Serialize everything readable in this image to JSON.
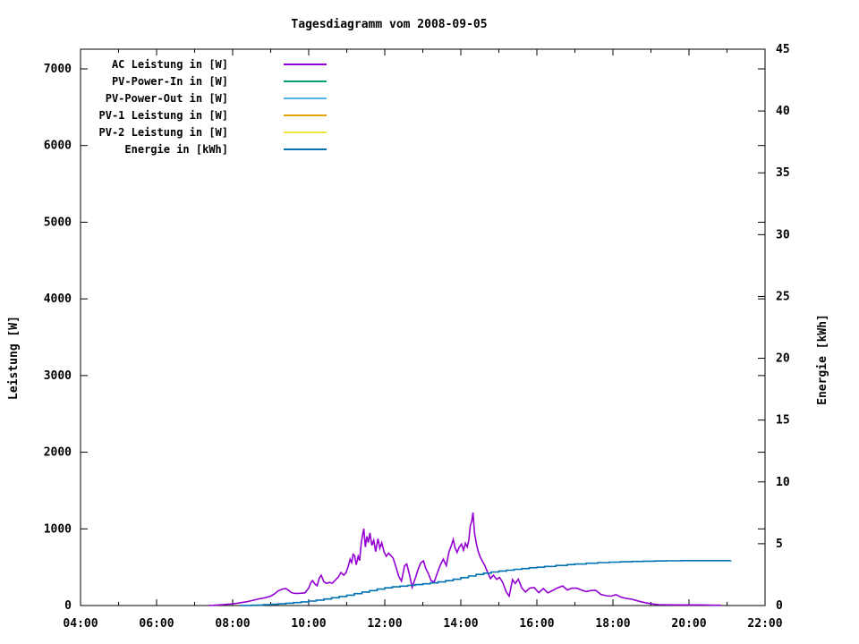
{
  "title": "Tagesdiagramm vom 2008-09-05",
  "colors": {
    "background": "#ffffff",
    "foreground": "#000000",
    "ac": "#9400d3",
    "pv_power_in": "#009e73",
    "pv_power_out": "#56b4e9",
    "pv1": "#e69f00",
    "pv2": "#f0e442",
    "energie": "#0072b2"
  },
  "chart_data": {
    "type": "line",
    "title": "Tagesdiagramm vom 2008-09-05",
    "grid": false,
    "legend_position": "top-left-inside",
    "x_axis": {
      "unit": "time-of-day",
      "min": 4,
      "max": 22,
      "major_tick_hours": 2,
      "minor_tick_hours": 1,
      "tick_labels": [
        "04:00",
        "06:00",
        "08:00",
        "10:00",
        "12:00",
        "14:00",
        "16:00",
        "18:00",
        "20:00",
        "22:00"
      ]
    },
    "y_axis_left": {
      "label": "Leistung [W]",
      "min": 0,
      "max": 7000,
      "tick_step": 1000,
      "tick_labels": [
        "0",
        "1000",
        "2000",
        "3000",
        "4000",
        "5000",
        "6000",
        "7000"
      ]
    },
    "y_axis_right": {
      "label": "Energie [kWh]",
      "min": 0,
      "max": 45,
      "tick_step": 5,
      "tick_labels": [
        "0",
        "5",
        "10",
        "15",
        "20",
        "25",
        "30",
        "35",
        "40",
        "45"
      ]
    },
    "series": [
      {
        "id": "ac-leistung",
        "name": "AC Leistung in [W]",
        "color": "#9400d3",
        "axis": "left",
        "step": false,
        "points": [
          [
            7.38,
            2
          ],
          [
            7.5,
            4
          ],
          [
            7.65,
            8
          ],
          [
            7.8,
            14
          ],
          [
            7.95,
            20
          ],
          [
            8.1,
            28
          ],
          [
            8.25,
            40
          ],
          [
            8.4,
            52
          ],
          [
            8.55,
            70
          ],
          [
            8.7,
            88
          ],
          [
            8.85,
            102
          ],
          [
            9.0,
            122
          ],
          [
            9.1,
            152
          ],
          [
            9.2,
            192
          ],
          [
            9.3,
            215
          ],
          [
            9.4,
            222
          ],
          [
            9.48,
            195
          ],
          [
            9.55,
            168
          ],
          [
            9.65,
            158
          ],
          [
            9.78,
            160
          ],
          [
            9.9,
            166
          ],
          [
            10.0,
            228
          ],
          [
            10.05,
            292
          ],
          [
            10.1,
            325
          ],
          [
            10.16,
            282
          ],
          [
            10.22,
            258
          ],
          [
            10.28,
            360
          ],
          [
            10.33,
            396
          ],
          [
            10.4,
            310
          ],
          [
            10.47,
            288
          ],
          [
            10.55,
            302
          ],
          [
            10.62,
            290
          ],
          [
            10.7,
            330
          ],
          [
            10.78,
            372
          ],
          [
            10.85,
            432
          ],
          [
            10.92,
            396
          ],
          [
            10.98,
            428
          ],
          [
            11.04,
            512
          ],
          [
            11.09,
            604
          ],
          [
            11.13,
            560
          ],
          [
            11.17,
            668
          ],
          [
            11.21,
            648
          ],
          [
            11.25,
            532
          ],
          [
            11.3,
            642
          ],
          [
            11.34,
            586
          ],
          [
            11.38,
            812
          ],
          [
            11.42,
            932
          ],
          [
            11.45,
            1002
          ],
          [
            11.49,
            764
          ],
          [
            11.53,
            902
          ],
          [
            11.57,
            822
          ],
          [
            11.61,
            948
          ],
          [
            11.66,
            784
          ],
          [
            11.71,
            852
          ],
          [
            11.76,
            704
          ],
          [
            11.82,
            872
          ],
          [
            11.87,
            748
          ],
          [
            11.92,
            820
          ],
          [
            11.98,
            700
          ],
          [
            12.04,
            642
          ],
          [
            12.1,
            684
          ],
          [
            12.16,
            652
          ],
          [
            12.22,
            618
          ],
          [
            12.3,
            492
          ],
          [
            12.37,
            378
          ],
          [
            12.44,
            318
          ],
          [
            12.52,
            518
          ],
          [
            12.58,
            542
          ],
          [
            12.65,
            402
          ],
          [
            12.72,
            238
          ],
          [
            12.8,
            352
          ],
          [
            12.88,
            478
          ],
          [
            12.95,
            558
          ],
          [
            13.02,
            582
          ],
          [
            13.08,
            482
          ],
          [
            13.15,
            412
          ],
          [
            13.22,
            322
          ],
          [
            13.3,
            308
          ],
          [
            13.38,
            422
          ],
          [
            13.46,
            528
          ],
          [
            13.54,
            606
          ],
          [
            13.62,
            522
          ],
          [
            13.69,
            702
          ],
          [
            13.75,
            782
          ],
          [
            13.8,
            862
          ],
          [
            13.85,
            752
          ],
          [
            13.9,
            692
          ],
          [
            13.96,
            762
          ],
          [
            14.02,
            802
          ],
          [
            14.07,
            722
          ],
          [
            14.12,
            812
          ],
          [
            14.17,
            764
          ],
          [
            14.21,
            852
          ],
          [
            14.25,
            1042
          ],
          [
            14.29,
            1102
          ],
          [
            14.32,
            1212
          ],
          [
            14.36,
            948
          ],
          [
            14.41,
            806
          ],
          [
            14.46,
            702
          ],
          [
            14.51,
            632
          ],
          [
            14.57,
            576
          ],
          [
            14.63,
            522
          ],
          [
            14.7,
            436
          ],
          [
            14.78,
            352
          ],
          [
            14.86,
            396
          ],
          [
            14.94,
            342
          ],
          [
            15.02,
            366
          ],
          [
            15.1,
            302
          ],
          [
            15.19,
            182
          ],
          [
            15.27,
            122
          ],
          [
            15.36,
            338
          ],
          [
            15.43,
            288
          ],
          [
            15.51,
            344
          ],
          [
            15.6,
            232
          ],
          [
            15.7,
            176
          ],
          [
            15.81,
            228
          ],
          [
            15.93,
            236
          ],
          [
            16.05,
            168
          ],
          [
            16.17,
            222
          ],
          [
            16.29,
            166
          ],
          [
            16.42,
            198
          ],
          [
            16.55,
            232
          ],
          [
            16.68,
            256
          ],
          [
            16.8,
            202
          ],
          [
            16.92,
            228
          ],
          [
            17.05,
            226
          ],
          [
            17.18,
            202
          ],
          [
            17.3,
            182
          ],
          [
            17.42,
            196
          ],
          [
            17.55,
            198
          ],
          [
            17.68,
            146
          ],
          [
            17.82,
            128
          ],
          [
            17.95,
            122
          ],
          [
            18.08,
            142
          ],
          [
            18.22,
            108
          ],
          [
            18.36,
            92
          ],
          [
            18.5,
            82
          ],
          [
            18.64,
            62
          ],
          [
            18.78,
            44
          ],
          [
            18.92,
            30
          ],
          [
            19.06,
            20
          ],
          [
            19.2,
            12
          ],
          [
            19.4,
            9
          ],
          [
            19.7,
            8
          ],
          [
            20.0,
            8
          ],
          [
            20.3,
            8
          ],
          [
            20.6,
            6
          ],
          [
            20.85,
            3
          ]
        ]
      },
      {
        "id": "pv-power-in",
        "name": "PV-Power-In in [W]",
        "color": "#009e73",
        "axis": "left",
        "step": false,
        "points": []
      },
      {
        "id": "pv-power-out",
        "name": "PV-Power-Out in [W]",
        "color": "#56b4e9",
        "axis": "left",
        "step": false,
        "points": []
      },
      {
        "id": "pv1-leistung",
        "name": "PV-1 Leistung in [W]",
        "color": "#e69f00",
        "axis": "left",
        "step": false,
        "points": []
      },
      {
        "id": "pv2-leistung",
        "name": "PV-2 Leistung in [W]",
        "color": "#f0e442",
        "axis": "left",
        "step": false,
        "points": []
      },
      {
        "id": "energie",
        "name": "Energie in [kWh]",
        "color": "#0072b2",
        "axis": "right",
        "step": true,
        "points": [
          [
            8.2,
            0.01
          ],
          [
            8.5,
            0.03
          ],
          [
            8.8,
            0.07
          ],
          [
            9.0,
            0.1
          ],
          [
            9.2,
            0.14
          ],
          [
            9.4,
            0.19
          ],
          [
            9.6,
            0.24
          ],
          [
            9.8,
            0.3
          ],
          [
            10.0,
            0.36
          ],
          [
            10.2,
            0.44
          ],
          [
            10.4,
            0.53
          ],
          [
            10.6,
            0.63
          ],
          [
            10.8,
            0.73
          ],
          [
            11.0,
            0.84
          ],
          [
            11.2,
            0.96
          ],
          [
            11.4,
            1.09
          ],
          [
            11.6,
            1.21
          ],
          [
            11.8,
            1.33
          ],
          [
            12.0,
            1.43
          ],
          [
            12.2,
            1.51
          ],
          [
            12.4,
            1.57
          ],
          [
            12.6,
            1.63
          ],
          [
            12.8,
            1.69
          ],
          [
            13.0,
            1.76
          ],
          [
            13.2,
            1.83
          ],
          [
            13.4,
            1.91
          ],
          [
            13.6,
            2.01
          ],
          [
            13.8,
            2.13
          ],
          [
            14.0,
            2.26
          ],
          [
            14.2,
            2.39
          ],
          [
            14.4,
            2.52
          ],
          [
            14.6,
            2.62
          ],
          [
            14.8,
            2.71
          ],
          [
            15.0,
            2.79
          ],
          [
            15.2,
            2.86
          ],
          [
            15.4,
            2.93
          ],
          [
            15.6,
            2.99
          ],
          [
            15.8,
            3.05
          ],
          [
            16.0,
            3.1
          ],
          [
            16.2,
            3.16
          ],
          [
            16.5,
            3.24
          ],
          [
            16.8,
            3.31
          ],
          [
            17.0,
            3.36
          ],
          [
            17.3,
            3.42
          ],
          [
            17.6,
            3.47
          ],
          [
            17.9,
            3.51
          ],
          [
            18.2,
            3.54
          ],
          [
            18.5,
            3.57
          ],
          [
            18.8,
            3.59
          ],
          [
            19.1,
            3.6
          ],
          [
            19.4,
            3.62
          ],
          [
            19.8,
            3.63
          ],
          [
            20.4,
            3.63
          ],
          [
            21.1,
            3.64
          ]
        ]
      }
    ]
  }
}
